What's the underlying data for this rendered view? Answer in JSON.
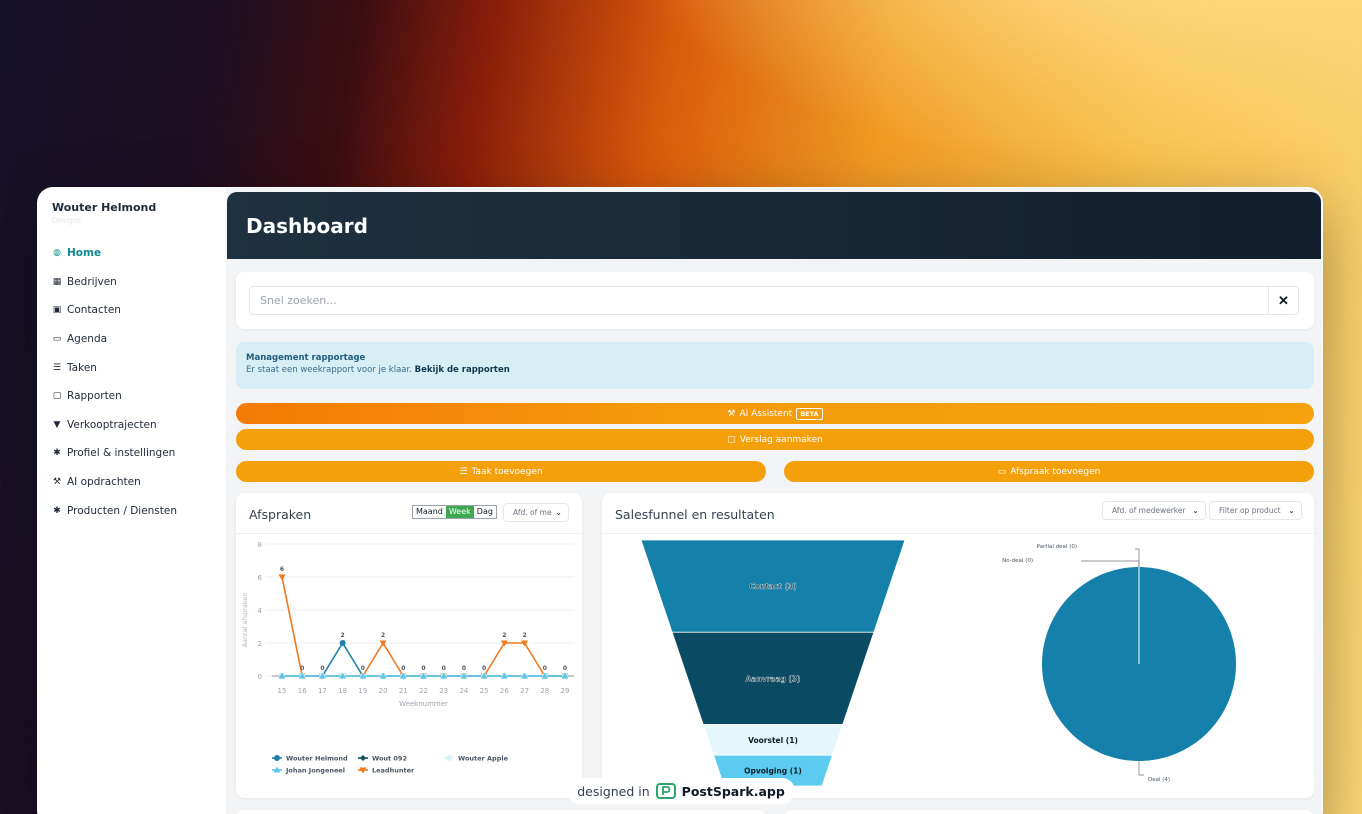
{
  "sidebar": {
    "company": "Wouter Helmond",
    "subtitle": "Designs",
    "items": [
      {
        "label": "Home",
        "icon": "dashboard-icon",
        "glyph": "◍",
        "active": true
      },
      {
        "label": "Bedrijven",
        "icon": "building-icon",
        "glyph": "▦"
      },
      {
        "label": "Contacten",
        "icon": "contact-card-icon",
        "glyph": "▣"
      },
      {
        "label": "Agenda",
        "icon": "calendar-icon",
        "glyph": "▭"
      },
      {
        "label": "Taken",
        "icon": "task-list-icon",
        "glyph": "☰"
      },
      {
        "label": "Rapporten",
        "icon": "note-icon",
        "glyph": "▢"
      },
      {
        "label": "Verkooptrajecten",
        "icon": "funnel-icon",
        "glyph": "▼"
      },
      {
        "label": "Profiel & instellingen",
        "icon": "gear-icon",
        "glyph": "✱"
      },
      {
        "label": "AI opdrachten",
        "icon": "magic-wand-icon",
        "glyph": "⚒"
      },
      {
        "label": "Producten / Diensten",
        "icon": "gear-icon",
        "glyph": "✱"
      }
    ]
  },
  "header": {
    "title": "Dashboard"
  },
  "search": {
    "placeholder": "Snel zoeken...",
    "value": "",
    "clear_glyph": "✕"
  },
  "alert": {
    "title": "Management rapportage",
    "text": "Er staat een weekrapport voor je klaar.",
    "link": "Bekijk de rapporten"
  },
  "actions": {
    "ai_label": "AI Assistent",
    "ai_badge": "BETA",
    "verslag_label": "Verslag aanmaken",
    "taak_label": "Taak toevoegen",
    "afspraak_label": "Afspraak toevoegen"
  },
  "afspraken": {
    "title": "Afspraken",
    "periods": [
      "Maand",
      "Week",
      "Dag"
    ],
    "active_period": "Week",
    "filter": "Afd. of me"
  },
  "salesfunnel": {
    "title": "Salesfunnel en resultaten",
    "filter1": "Afd. of medewerker",
    "filter2": "Filter op product"
  },
  "footer_badge": {
    "prefix": "designed in",
    "brand": "PostSpark.app"
  },
  "colors": {
    "accent": "#f4a00a",
    "teal": "#0d8a8f",
    "header": "#172634"
  },
  "chart_data": [
    {
      "type": "line",
      "title": "",
      "xlabel": "Weeknummer",
      "ylabel": "Aantal afspraken",
      "x": [
        15,
        16,
        17,
        18,
        19,
        20,
        21,
        22,
        23,
        24,
        25,
        26,
        27,
        28,
        29
      ],
      "ylim": [
        0,
        8
      ],
      "yticks": [
        0,
        2,
        4,
        6,
        8
      ],
      "grid": true,
      "legend": "bottom",
      "series": [
        {
          "name": "Wouter Helmond",
          "color": "#1d7fa8",
          "marker": "circle",
          "values": [
            0,
            0,
            0,
            2,
            0,
            0,
            0,
            0,
            0,
            0,
            0,
            0,
            0,
            0,
            0
          ]
        },
        {
          "name": "Wout 092",
          "color": "#0f4a63",
          "marker": "diamond",
          "values": [
            0,
            0,
            0,
            0,
            0,
            0,
            0,
            0,
            0,
            0,
            0,
            0,
            0,
            0,
            0
          ]
        },
        {
          "name": "Wouter Apple",
          "color": "#d8f4f8",
          "marker": "circle",
          "values": [
            0,
            0,
            0,
            0,
            0,
            0,
            0,
            0,
            0,
            0,
            0,
            0,
            0,
            0,
            0
          ]
        },
        {
          "name": "Johan Jongeneel",
          "color": "#5ec6ea",
          "marker": "triangle",
          "values": [
            0,
            0,
            0,
            0,
            0,
            0,
            0,
            0,
            0,
            0,
            0,
            0,
            0,
            0,
            0
          ]
        },
        {
          "name": "Leadhunter",
          "color": "#f0781e",
          "marker": "triangle-down",
          "values": [
            6,
            0,
            0,
            0,
            0,
            2,
            0,
            0,
            0,
            0,
            0,
            2,
            2,
            0,
            0
          ]
        }
      ]
    },
    {
      "type": "funnel",
      "title": "",
      "categories": [
        "Contact (3)",
        "Aanvraag (3)",
        "Voorstel (1)",
        "Opvolging (1)"
      ],
      "values": [
        3,
        3,
        1,
        1
      ],
      "colors": [
        "#1580aa",
        "#0b4a63",
        "#e5f7fb",
        "#5ccbf0"
      ]
    },
    {
      "type": "pie",
      "title": "",
      "categories": [
        "Deal (4)",
        "No-deal (0)",
        "Partial deal (0)"
      ],
      "values": [
        4,
        0,
        0
      ],
      "colors": [
        "#1580aa",
        "#0b4a63",
        "#5ccbf0"
      ]
    }
  ]
}
